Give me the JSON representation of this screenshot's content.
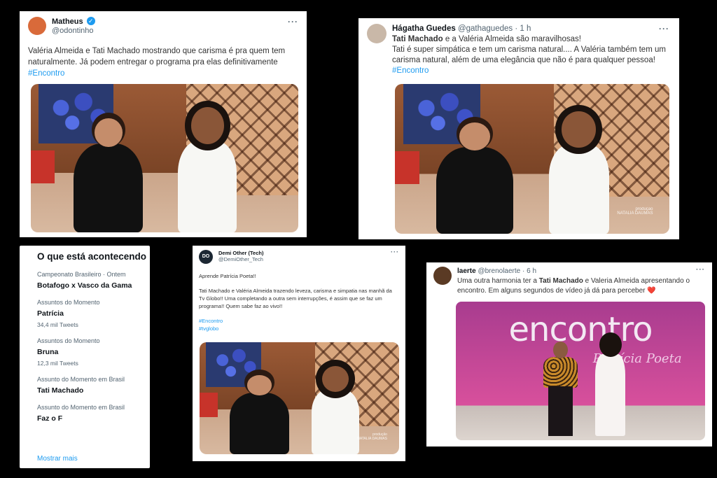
{
  "tweet1": {
    "name": "Matheus",
    "handle": "@odontinho",
    "more": "···",
    "text": "Valéria Almeida e Tati Machado mostrando que carisma é pra quem tem naturalmente. Já podem entregar o programa pra elas definitivamente",
    "hashtag": "#Encontro"
  },
  "tweet2": {
    "name": "Hágatha Guedes",
    "handle": "@gathaguedes · 1 h",
    "more": "···",
    "line1_bold": "Tati Machado",
    "line1_rest": " e a Valéria Almeida são maravilhosas!",
    "text": "Tati é super simpática e tem um carisma natural.... A Valéria também tem um carisma natural, além de uma elegância que não é para qualquer pessoa!",
    "hashtag": "#Encontro",
    "watermark_label": "produção",
    "watermark_name": "NATALIA DAUMAS"
  },
  "trends": {
    "title": "O que está acontecendo",
    "items": [
      {
        "category": "Campeonato Brasileiro · Ontem",
        "name": "Botafogo x Vasco da Gama",
        "count": ""
      },
      {
        "category": "Assuntos do Momento",
        "name": "Patrícia",
        "count": "34,4 mil Tweets"
      },
      {
        "category": "Assuntos do Momento",
        "name": "Bruna",
        "count": "12,3 mil Tweets"
      },
      {
        "category": "Assunto do Momento em Brasil",
        "name": "Tati Machado",
        "count": ""
      },
      {
        "category": "Assunto do Momento em Brasil",
        "name": "Faz o F",
        "count": ""
      }
    ],
    "show_more": "Mostrar mais"
  },
  "tweet3": {
    "name": "Demi Other (Tech)",
    "handle": "@DemiOther_Tech",
    "more": "···",
    "avatar_text": "DO",
    "p1": "Aprende Patrícia Poeta!!",
    "p2": "Tati Machado e Valéria Almeida trazendo leveza, carisma e simpatia nas manhã da Tv Globo!! Uma completando a outra sem interrupções, é assim que se faz um programa!! Quem sabe faz ao vivo!!",
    "hashtag1": "#Encontro",
    "hashtag2": "#tvglobo",
    "watermark_label": "produção",
    "watermark_name": "NATALIA DAUMAS"
  },
  "tweet4": {
    "name": "laerte",
    "handle": "@brenolaerte · 6 h",
    "more": "···",
    "text_a": "Uma outra harmonia ter a ",
    "text_bold": "Tati Machado",
    "text_b": " e Valeria Almeida apresentando o encontro. Em alguns segundos de vídeo já dá para perceber ",
    "emoji": "❤️",
    "logo": "encontro",
    "logo_sub": "Patrícia Poeta"
  }
}
